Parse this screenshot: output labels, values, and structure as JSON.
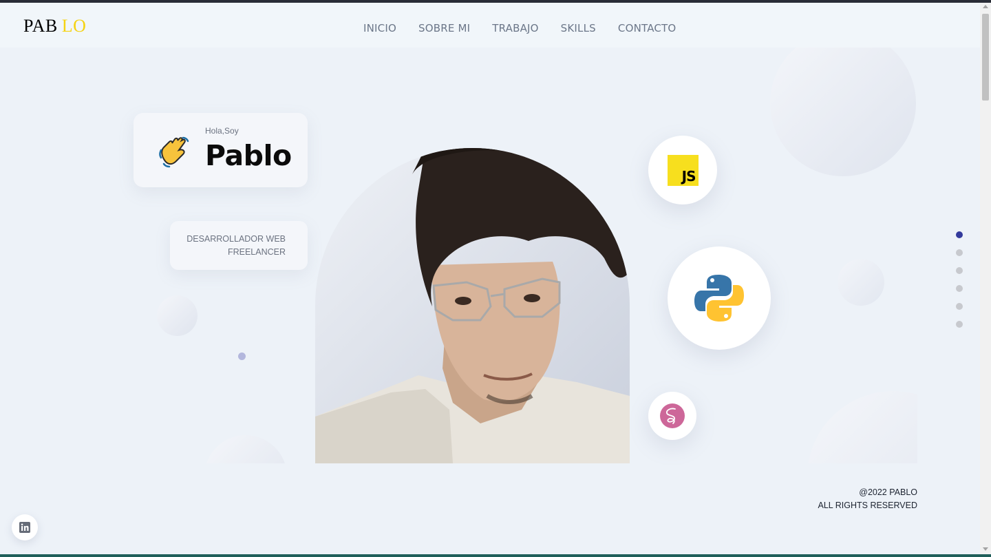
{
  "header": {
    "logo_part1": "PAB",
    "logo_part2": "LO",
    "nav": [
      {
        "label": "INICIO"
      },
      {
        "label": "SOBRE MI"
      },
      {
        "label": "TRABAJO"
      },
      {
        "label": "SKILLS"
      },
      {
        "label": "CONTACTO"
      }
    ]
  },
  "hero": {
    "greeting": "Hola,Soy",
    "name": "Pablo",
    "role_line1": "DESARROLLADOR WEB",
    "role_line2": "FREELANCER"
  },
  "skills_badges": [
    {
      "icon": "javascript-icon",
      "label": "JS"
    },
    {
      "icon": "python-icon"
    },
    {
      "icon": "sass-icon"
    }
  ],
  "page_dots": {
    "count": 6,
    "active_index": 0
  },
  "footer": {
    "copyright": "@2022 PABLO",
    "rights": "ALL RIGHTS RESERVED"
  },
  "social": [
    {
      "icon": "linkedin-icon"
    }
  ],
  "colors": {
    "accent": "#f5d312",
    "active_dot": "#333a9c",
    "background": "#edf2f8"
  }
}
